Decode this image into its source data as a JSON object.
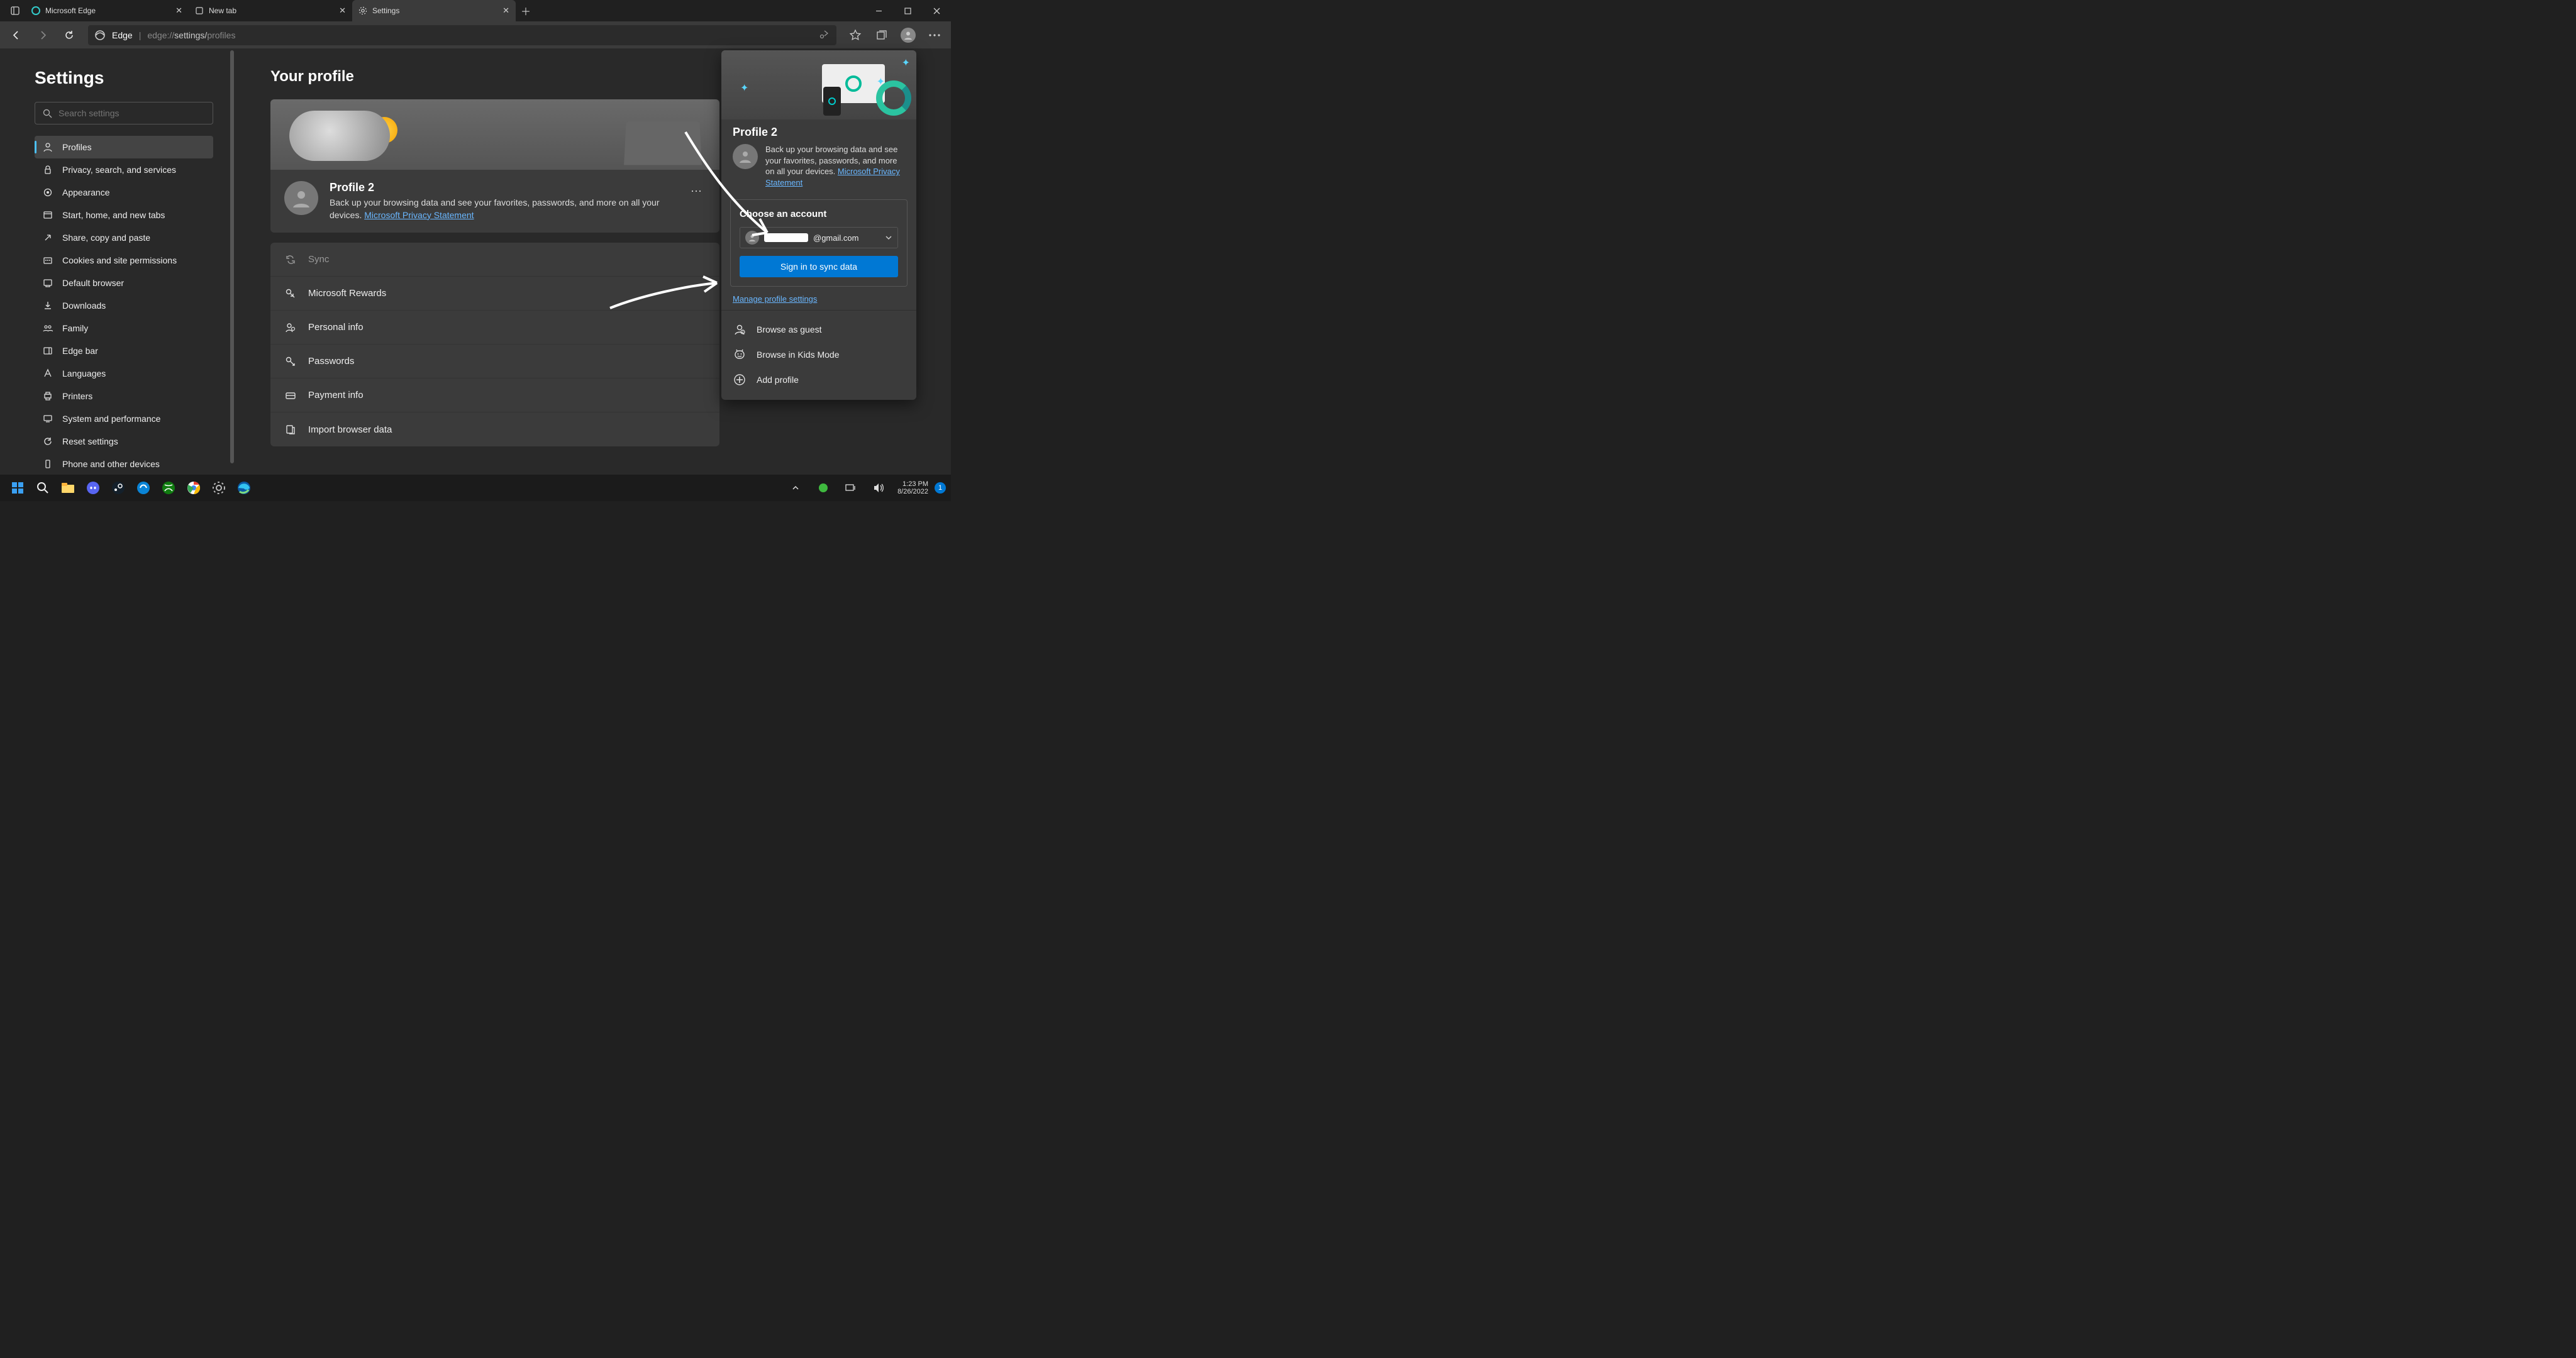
{
  "window": {
    "tabs": [
      {
        "title": "Microsoft Edge",
        "active": false
      },
      {
        "title": "New tab",
        "active": false
      },
      {
        "title": "Settings",
        "active": true
      }
    ]
  },
  "toolbar": {
    "brand": "Edge",
    "url_prefix": "edge://",
    "url_path": "settings/",
    "url_leaf": "profiles"
  },
  "sidebar": {
    "title": "Settings",
    "search_placeholder": "Search settings",
    "items": [
      {
        "label": "Profiles",
        "active": true
      },
      {
        "label": "Privacy, search, and services"
      },
      {
        "label": "Appearance"
      },
      {
        "label": "Start, home, and new tabs"
      },
      {
        "label": "Share, copy and paste"
      },
      {
        "label": "Cookies and site permissions"
      },
      {
        "label": "Default browser"
      },
      {
        "label": "Downloads"
      },
      {
        "label": "Family"
      },
      {
        "label": "Edge bar"
      },
      {
        "label": "Languages"
      },
      {
        "label": "Printers"
      },
      {
        "label": "System and performance"
      },
      {
        "label": "Reset settings"
      },
      {
        "label": "Phone and other devices"
      }
    ]
  },
  "main": {
    "heading": "Your profile",
    "profile_name": "Profile 2",
    "profile_desc": "Back up your browsing data and see your favorites, passwords, and more on all your devices. ",
    "privacy_link": "Microsoft Privacy Statement",
    "rows": [
      {
        "label": "Sync",
        "dim": true
      },
      {
        "label": "Microsoft Rewards"
      },
      {
        "label": "Personal info"
      },
      {
        "label": "Passwords"
      },
      {
        "label": "Payment info"
      },
      {
        "label": "Import browser data"
      }
    ]
  },
  "flyout": {
    "profile_name": "Profile 2",
    "blurb": "Back up your browsing data and see your favorites, passwords, and more on all your devices.",
    "privacy_link": "Microsoft Privacy Statement",
    "choose_title": "Choose an account",
    "account_suffix": "@gmail.com",
    "signin_label": "Sign in to sync data",
    "manage_link": "Manage profile settings",
    "actions": [
      {
        "label": "Browse as guest"
      },
      {
        "label": "Browse in Kids Mode"
      },
      {
        "label": "Add profile"
      }
    ]
  },
  "taskbar": {
    "time": "1:23 PM",
    "date": "8/26/2022",
    "badge": "1"
  }
}
